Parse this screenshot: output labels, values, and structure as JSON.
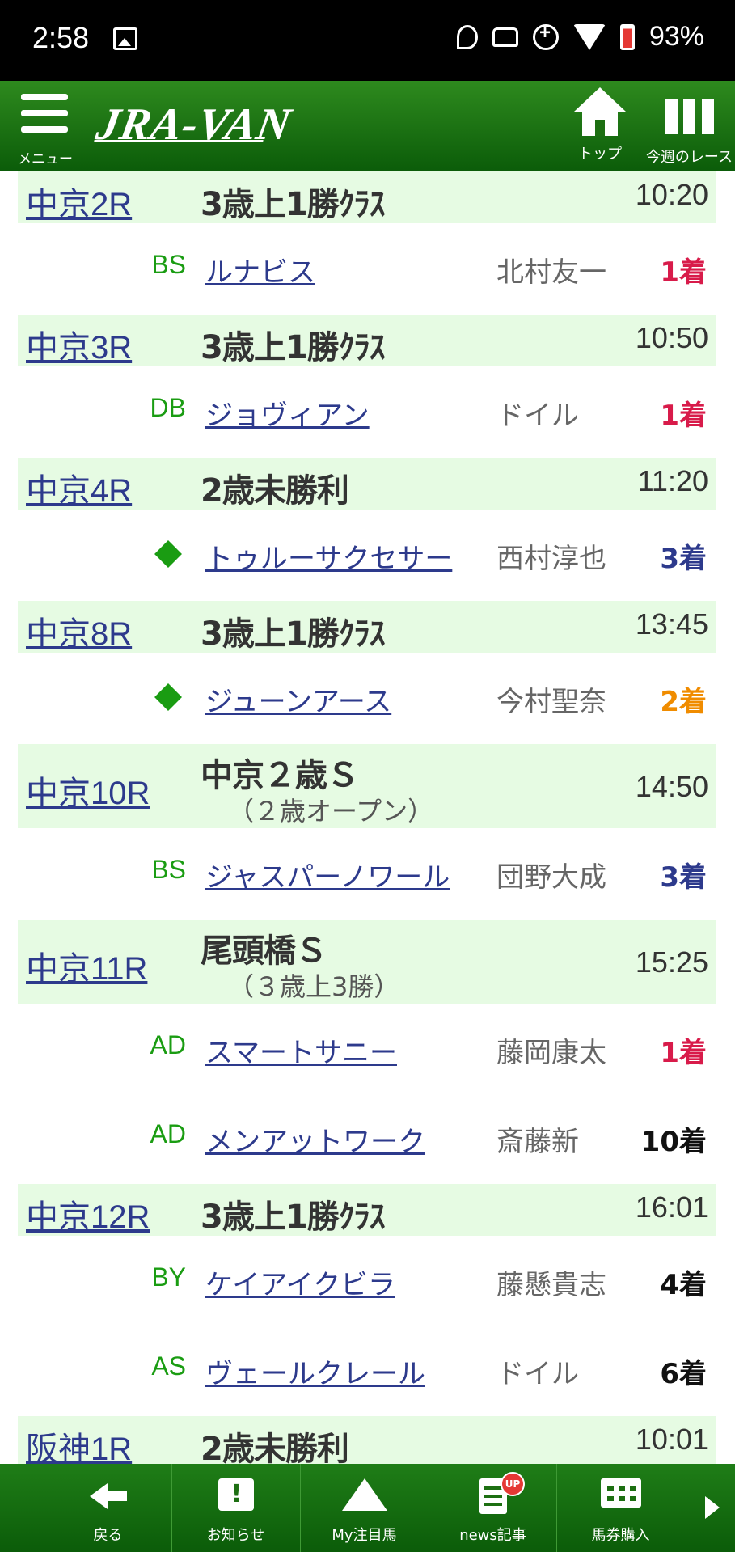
{
  "status_bar": {
    "time": "2:58",
    "battery": "93%"
  },
  "header": {
    "menu_label": "メニュー",
    "logo": "JRA-VAN",
    "top_label": "トップ",
    "week_label": "今週のレース"
  },
  "races": [
    {
      "race": "中京2R",
      "title": "3歳上1勝ｸﾗｽ",
      "subtitle": "",
      "time": "10:20",
      "horses": [
        {
          "mark": "BS",
          "name": "ルナビス",
          "jockey": "北村友一",
          "result": "1着",
          "result_color": "#d81b4a"
        }
      ]
    },
    {
      "race": "中京3R",
      "title": "3歳上1勝ｸﾗｽ",
      "subtitle": "",
      "time": "10:50",
      "horses": [
        {
          "mark": "DB",
          "name": "ジョヴィアン",
          "jockey": "ドイル",
          "result": "1着",
          "result_color": "#d81b4a"
        }
      ]
    },
    {
      "race": "中京4R",
      "title": "2歳未勝利",
      "subtitle": "",
      "time": "11:20",
      "horses": [
        {
          "mark": "diamond",
          "name": "トゥルーサクセサー",
          "jockey": "西村淳也",
          "result": "3着",
          "result_color": "#2d3a8c"
        }
      ]
    },
    {
      "race": "中京8R",
      "title": "3歳上1勝ｸﾗｽ",
      "subtitle": "",
      "time": "13:45",
      "horses": [
        {
          "mark": "diamond",
          "name": "ジューンアース",
          "jockey": "今村聖奈",
          "result": "2着",
          "result_color": "#f08c00"
        }
      ]
    },
    {
      "race": "中京10R",
      "title": "中京２歳Ｓ",
      "subtitle": "（２歳オープン）",
      "time": "14:50",
      "horses": [
        {
          "mark": "BS",
          "name": "ジャスパーノワール",
          "jockey": "団野大成",
          "result": "3着",
          "result_color": "#2d3a8c"
        }
      ]
    },
    {
      "race": "中京11R",
      "title": "尾頭橋Ｓ",
      "subtitle": "（３歳上3勝）",
      "time": "15:25",
      "horses": [
        {
          "mark": "AD",
          "name": "スマートサニー",
          "jockey": "藤岡康太",
          "result": "1着",
          "result_color": "#d81b4a"
        },
        {
          "mark": "AD",
          "name": "メンアットワーク",
          "jockey": "斎藤新",
          "result": "10着",
          "result_color": "#111111"
        }
      ]
    },
    {
      "race": "中京12R",
      "title": "3歳上1勝ｸﾗｽ",
      "subtitle": "",
      "time": "16:01",
      "horses": [
        {
          "mark": "BY",
          "name": "ケイアイクビラ",
          "jockey": "藤懸貴志",
          "result": "4着",
          "result_color": "#111111"
        },
        {
          "mark": "AS",
          "name": "ヴェールクレール",
          "jockey": "ドイル",
          "result": "6着",
          "result_color": "#111111"
        }
      ]
    },
    {
      "race": "阪神1R",
      "title": "2歳未勝利",
      "subtitle": "",
      "time": "10:01",
      "horses": []
    }
  ],
  "bottom_nav": [
    {
      "label": "戻る",
      "icon": "back-arrow-icon"
    },
    {
      "label": "お知らせ",
      "icon": "notice-icon"
    },
    {
      "label": "My注目馬",
      "icon": "favorite-horse-icon"
    },
    {
      "label": "news記事",
      "icon": "news-icon",
      "badge": "UP"
    },
    {
      "label": "馬券購入",
      "icon": "ticket-icon"
    }
  ],
  "colors": {
    "header_green": "#1d6f12",
    "row_bg": "#e6fbe3",
    "link": "#2d3a8c",
    "mark_green": "#1a9c12"
  }
}
